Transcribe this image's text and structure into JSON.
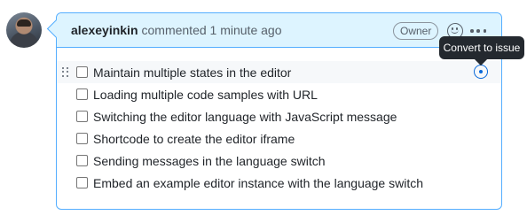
{
  "comment": {
    "author": "alexeyinkin",
    "meta": "commented 1 minute ago",
    "badge": "Owner",
    "tooltip": "Convert to issue"
  },
  "icons": {
    "avatar": "avatar",
    "emoji": "smiley-icon",
    "more": "kebab-horizontal-icon",
    "drag": "grabber-icon",
    "convert": "issue-opened-icon"
  },
  "colors": {
    "header_bg": "#ddf4ff",
    "border": "#54aeff",
    "accent": "#0969da",
    "tooltip_bg": "#24292f"
  },
  "tasks": [
    {
      "label": "Maintain multiple states in the editor",
      "checked": false
    },
    {
      "label": "Loading multiple code samples with URL",
      "checked": false
    },
    {
      "label": "Switching the editor language with JavaScript message",
      "checked": false
    },
    {
      "label": "Shortcode to create the editor iframe",
      "checked": false
    },
    {
      "label": "Sending messages in the language switch",
      "checked": false
    },
    {
      "label": "Embed an example editor instance with the language switch",
      "checked": false
    }
  ]
}
